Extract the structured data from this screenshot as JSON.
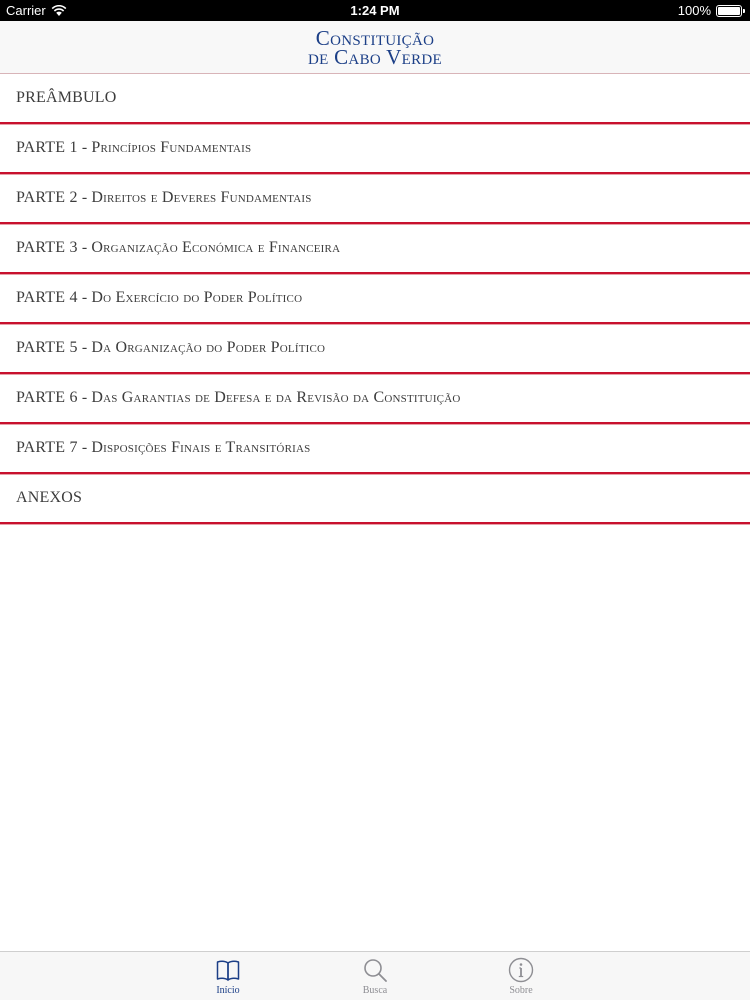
{
  "status_bar": {
    "carrier": "Carrier",
    "time": "1:24 PM",
    "battery_percent": "100%",
    "battery_level": 1.0
  },
  "header": {
    "title_line1": "Constituição",
    "title_line2": "de Cabo Verde",
    "accent_color": "#1c3f87",
    "divider_color": "#c8102e"
  },
  "list": {
    "items": [
      {
        "label": "PREÂMBULO",
        "title": ""
      },
      {
        "label": "PARTE 1 -",
        "title": "Princípios Fundamentais"
      },
      {
        "label": "PARTE 2 -",
        "title": "Direitos e Deveres Fundamentais"
      },
      {
        "label": "PARTE 3 -",
        "title": "Organização Económica e Financeira"
      },
      {
        "label": "PARTE 4 -",
        "title": "Do Exercício do Poder Político"
      },
      {
        "label": "PARTE 5 -",
        "title": "Da Organização do Poder Político"
      },
      {
        "label": "PARTE 6 -",
        "title": "Das Garantias de Defesa e da Revisão da Constituição"
      },
      {
        "label": "PARTE 7 -",
        "title": "Disposições Finais e Transitórias"
      },
      {
        "label": "ANEXOS",
        "title": ""
      }
    ]
  },
  "tab_bar": {
    "tabs": [
      {
        "label": "Início",
        "icon": "book-icon",
        "active": true
      },
      {
        "label": "Busca",
        "icon": "search-icon",
        "active": false
      },
      {
        "label": "Sobre",
        "icon": "info-icon",
        "active": false
      }
    ]
  }
}
